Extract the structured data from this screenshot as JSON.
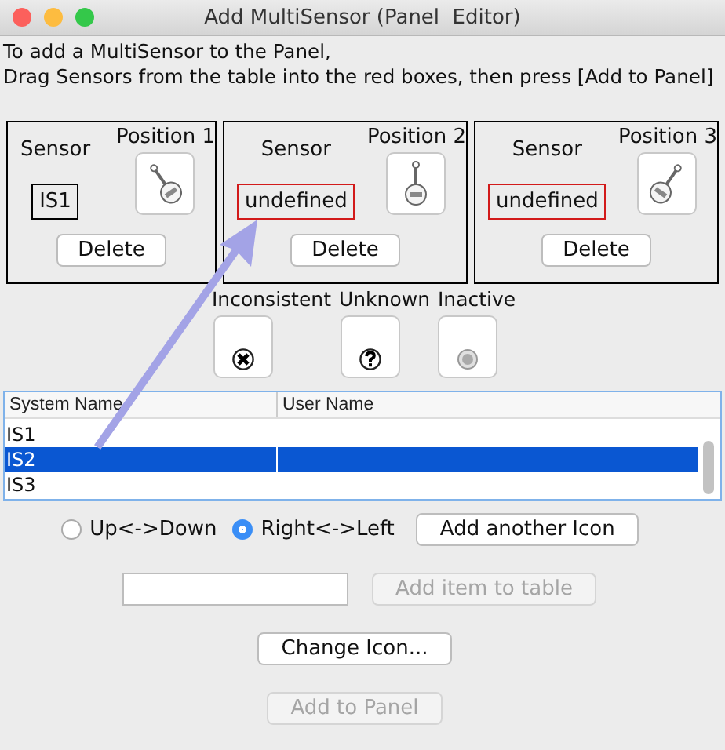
{
  "window": {
    "title": "Add MultiSensor (Panel  Editor)"
  },
  "instructions": [
    "To add a MultiSensor to the Panel,",
    "Drag Sensors from the table into the red boxes, then press [Add to Panel]"
  ],
  "positions": [
    {
      "sensor_label": "Sensor",
      "position_label": "Position 1",
      "sensor": "IS1",
      "assigned": true,
      "delete_button": "Delete"
    },
    {
      "sensor_label": "Sensor",
      "position_label": "Position 2",
      "sensor": "undefined",
      "assigned": false,
      "delete_button": "Delete"
    },
    {
      "sensor_label": "Sensor",
      "position_label": "Position 3",
      "sensor": "undefined",
      "assigned": false,
      "delete_button": "Delete"
    }
  ],
  "states": [
    {
      "label": "Inconsistent",
      "kind": "inconsistent"
    },
    {
      "label": "Unknown",
      "kind": "unknown"
    },
    {
      "label": "Inactive",
      "kind": "inactive"
    }
  ],
  "table": {
    "columns": [
      "System Name",
      "User Name"
    ],
    "rows": [
      {
        "system_name": "IS1",
        "selected": false
      },
      {
        "system_name": "IS2",
        "selected": true
      },
      {
        "system_name": "IS3",
        "selected": false
      }
    ]
  },
  "orientation": [
    {
      "label": "Up<->Down",
      "selected": false
    },
    {
      "label": "Right<->Left",
      "selected": true
    }
  ],
  "add_icon_button": "Add another Icon",
  "add_item_button": {
    "label": "Add item to table",
    "disabled": true
  },
  "change_icon_button": {
    "label": "Change Icon...",
    "disabled": false
  },
  "add_panel_button": {
    "label": "Add to Panel",
    "disabled": true
  }
}
